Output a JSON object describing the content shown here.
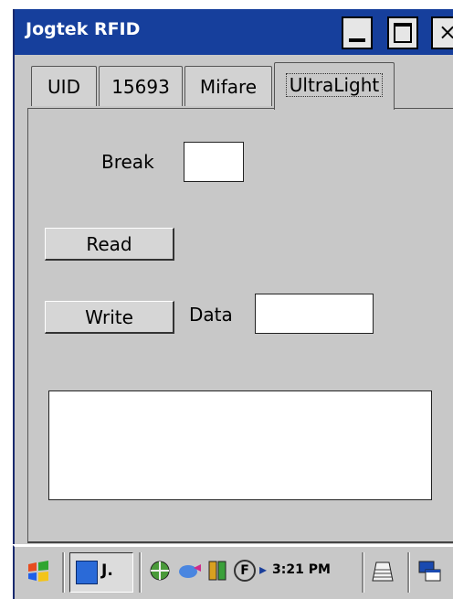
{
  "window": {
    "title": "Jogtek RFID",
    "close_glyph": "×"
  },
  "tabs": [
    "UID",
    "15693",
    "Mifare",
    "UltraLight"
  ],
  "form": {
    "break_label": "Break",
    "break_value": "",
    "read_button": "Read",
    "write_button": "Write",
    "data_label": "Data",
    "data_value": "",
    "output_value": ""
  },
  "taskbar": {
    "start_icon": "windows-flag-icon",
    "app_label": "J.",
    "clock": "3:21 PM",
    "tray_f": "F",
    "arrow": "▸"
  }
}
